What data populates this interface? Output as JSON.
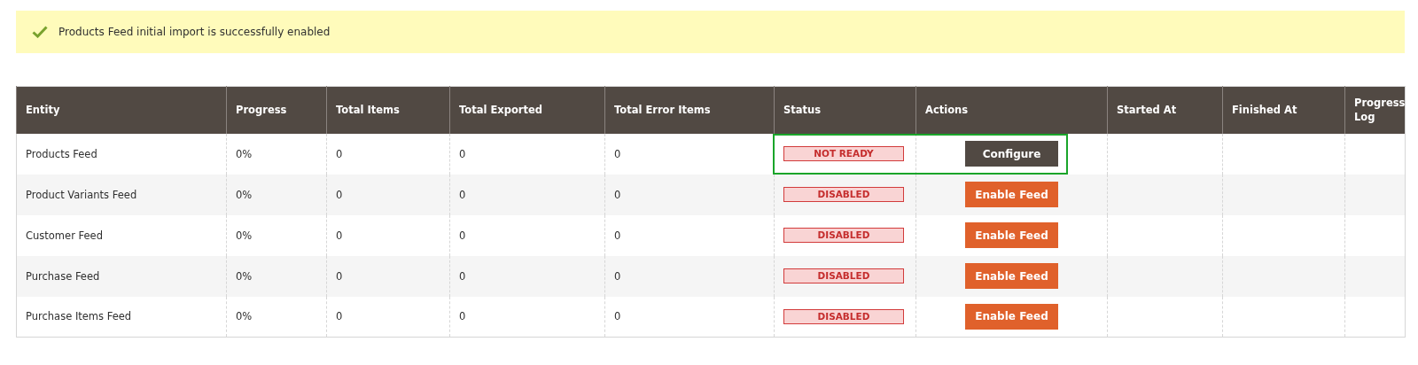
{
  "message": {
    "kind": "success",
    "text": "Products Feed initial import is successfully enabled"
  },
  "table": {
    "columns": [
      "Entity",
      "Progress",
      "Total Items",
      "Total Exported",
      "Total Error Items",
      "Status",
      "Actions",
      "Started At",
      "Finished At",
      "Progress Log"
    ],
    "rows": [
      {
        "entity": "Products Feed",
        "progress": "0%",
        "total_items": "0",
        "total_exported": "0",
        "total_error_items": "0",
        "status": "NOT READY",
        "action": {
          "kind": "configure",
          "label": "Configure"
        },
        "highlighted": true
      },
      {
        "entity": "Product Variants Feed",
        "progress": "0%",
        "total_items": "0",
        "total_exported": "0",
        "total_error_items": "0",
        "status": "DISABLED",
        "action": {
          "kind": "enable",
          "label": "Enable Feed"
        },
        "highlighted": false
      },
      {
        "entity": "Customer Feed",
        "progress": "0%",
        "total_items": "0",
        "total_exported": "0",
        "total_error_items": "0",
        "status": "DISABLED",
        "action": {
          "kind": "enable",
          "label": "Enable Feed"
        },
        "highlighted": false
      },
      {
        "entity": "Purchase Feed",
        "progress": "0%",
        "total_items": "0",
        "total_exported": "0",
        "total_error_items": "0",
        "status": "DISABLED",
        "action": {
          "kind": "enable",
          "label": "Enable Feed"
        },
        "highlighted": false
      },
      {
        "entity": "Purchase Items Feed",
        "progress": "0%",
        "total_items": "0",
        "total_exported": "0",
        "total_error_items": "0",
        "status": "DISABLED",
        "action": {
          "kind": "enable",
          "label": "Enable Feed"
        },
        "highlighted": false
      }
    ]
  }
}
